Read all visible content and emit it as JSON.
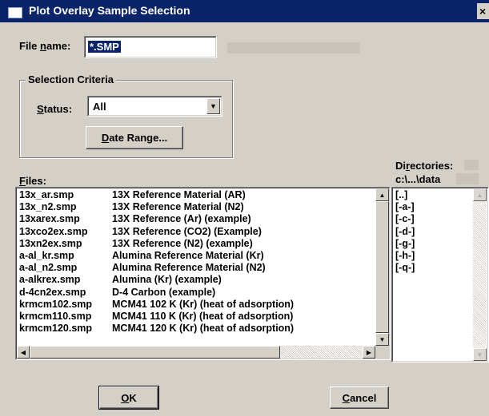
{
  "window": {
    "title": "Plot Overlay Sample Selection",
    "close_glyph": "×"
  },
  "file_name": {
    "label_prefix": "File ",
    "label_accel": "n",
    "label_suffix": "ame:",
    "value": "*.SMP"
  },
  "selection_criteria": {
    "title": "Selection Criteria",
    "status": {
      "label_accel": "S",
      "label_suffix": "tatus:",
      "value": "All"
    },
    "date_range_button": {
      "accel": "D",
      "rest": "ate Range..."
    }
  },
  "files": {
    "label_accel": "F",
    "label_suffix": "iles:",
    "items": [
      {
        "file": "13x_ar.smp",
        "desc": "13X Reference Material (AR)"
      },
      {
        "file": "13x_n2.smp",
        "desc": "13X Reference Material (N2)"
      },
      {
        "file": "13xarex.smp",
        "desc": "13X Reference (Ar) (example)"
      },
      {
        "file": "13xco2ex.smp",
        "desc": "13X Reference (CO2) (Example)"
      },
      {
        "file": "13xn2ex.smp",
        "desc": "13X Reference (N2) (example)"
      },
      {
        "file": "a-al_kr.smp",
        "desc": "Alumina Reference Material (Kr)"
      },
      {
        "file": "a-al_n2.smp",
        "desc": "Alumina Reference Material (N2)"
      },
      {
        "file": "a-alkrex.smp",
        "desc": "Alumina (Kr) (example)"
      },
      {
        "file": "d-4cn2ex.smp",
        "desc": "D-4 Carbon (example)"
      },
      {
        "file": "krmcm102.smp",
        "desc": "MCM41 102 K (Kr) (heat of adsorption)"
      },
      {
        "file": "krmcm110.smp",
        "desc": "MCM41 110 K (Kr) (heat of adsorption)"
      },
      {
        "file": "krmcm120.smp",
        "desc": "MCM41 120 K (Kr) (heat of adsorption)"
      }
    ]
  },
  "directories": {
    "label_prefix": "Di",
    "label_accel": "r",
    "label_suffix": "ectories:",
    "current_path": "c:\\...\\data",
    "items": [
      "[..]",
      "[-a-]",
      "[-c-]",
      "[-d-]",
      "[-g-]",
      "[-h-]",
      "[-q-]"
    ]
  },
  "buttons": {
    "ok": {
      "accel": "O",
      "rest": "K"
    },
    "cancel": {
      "accel": "C",
      "rest": "ancel"
    }
  },
  "icons": {
    "scroll_up": "▲",
    "scroll_down": "▼",
    "scroll_left": "◀",
    "scroll_right": "▶",
    "dropdown": "▼"
  }
}
